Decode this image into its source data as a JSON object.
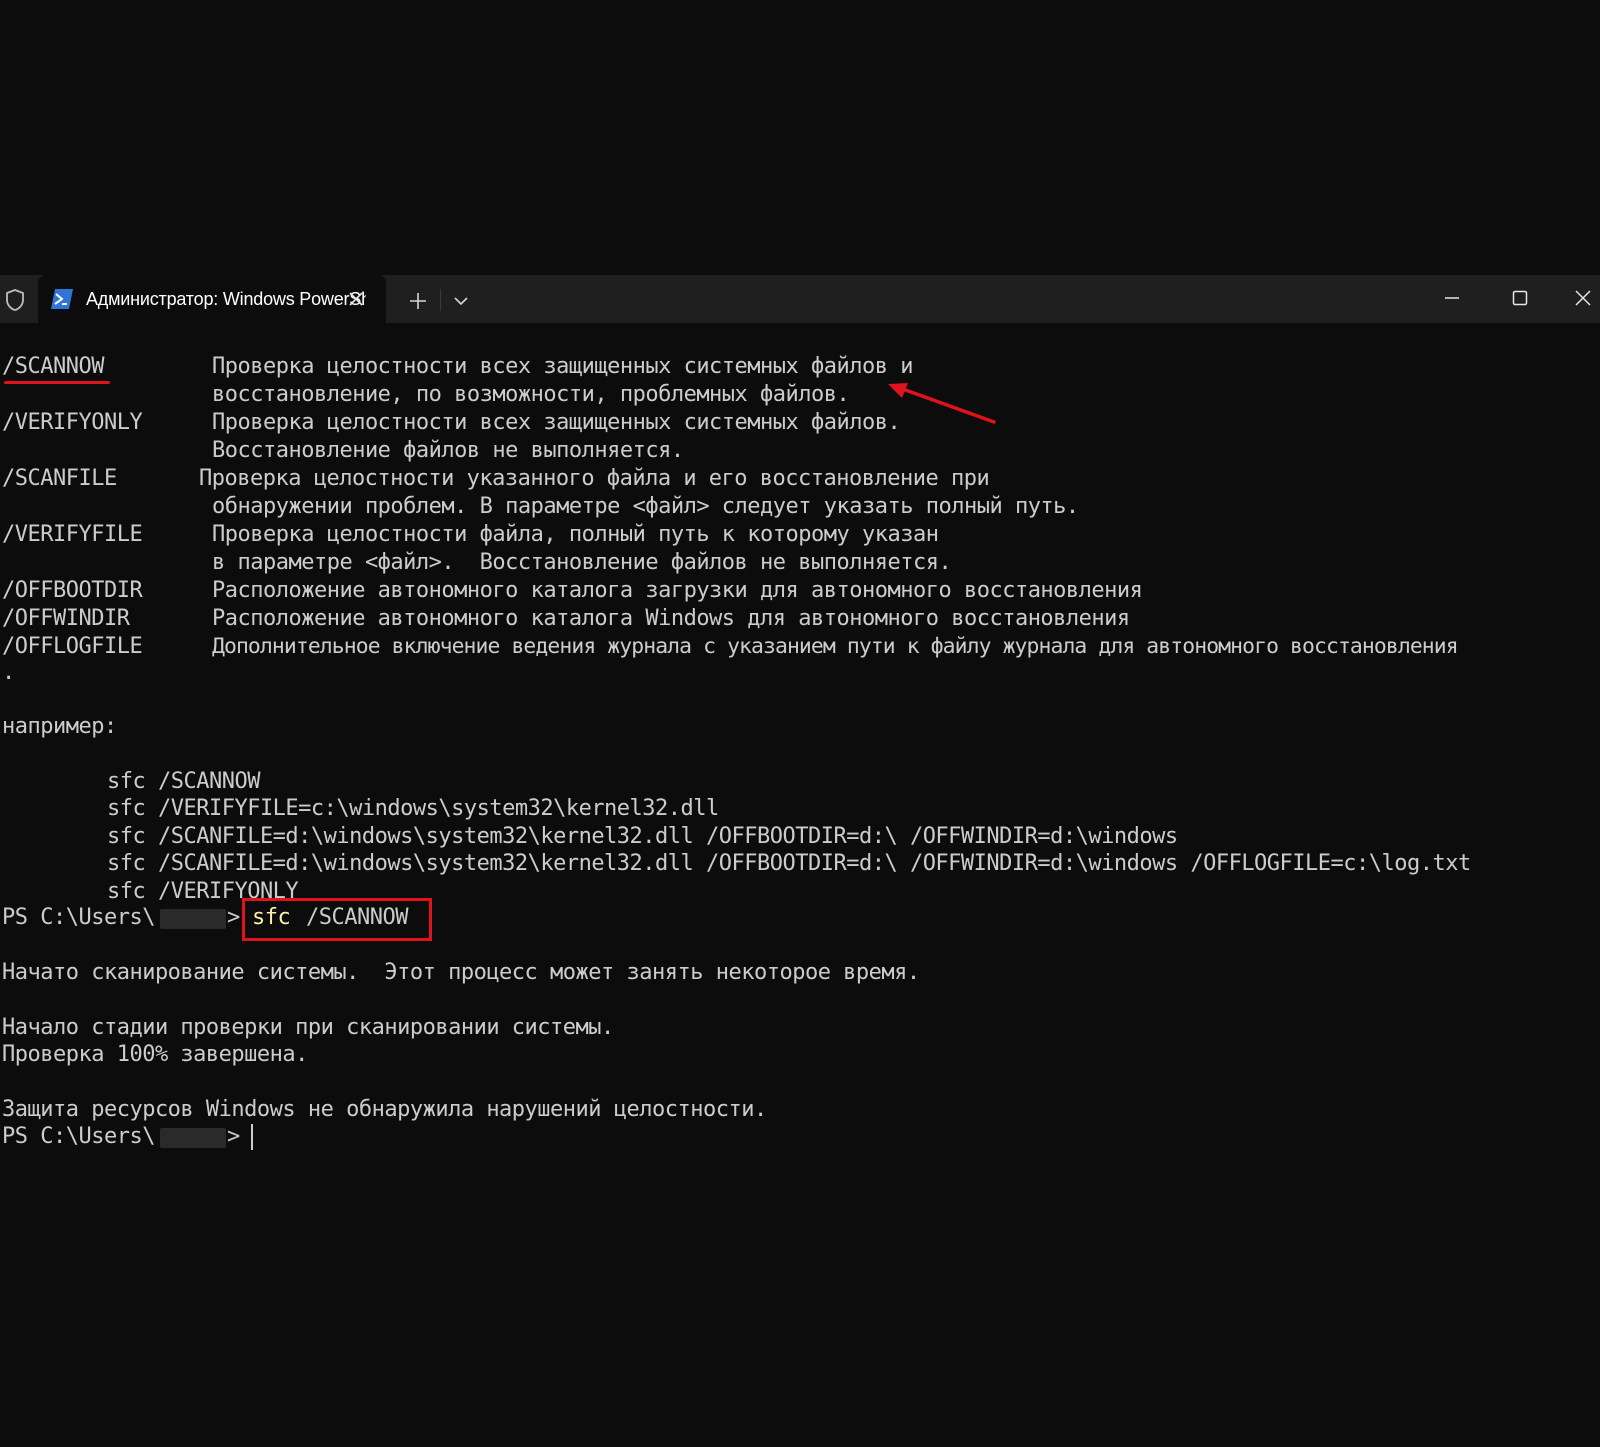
{
  "window": {
    "tab_title": "Администратор: Windows PowerShell"
  },
  "icons": {
    "shield": "shield-icon",
    "powershell": "powershell-icon",
    "close_tab": "close-icon",
    "new_tab": "plus-icon",
    "dropdown": "chevron-down-icon",
    "minimize": "minimize-icon",
    "maximize": "maximize-icon",
    "close_window": "close-icon"
  },
  "colors": {
    "terminal_bg": "#0c0c0c",
    "text": "#cccccc",
    "command": "#f9f1a5",
    "annotation": "#e0121b"
  },
  "help": [
    {
      "switch": "/SCANNOW",
      "text": "Проверка целостности всех защищенных системных файлов и"
    },
    {
      "switch": "",
      "text": "восстановление, по возможности, проблемных файлов."
    },
    {
      "switch": "/VERIFYONLY",
      "text": "Проверка целостности всех защищенных системных файлов."
    },
    {
      "switch": "",
      "text": "Восстановление файлов не выполняется."
    },
    {
      "switch": "/SCANFILE",
      "text": "Проверка целостности указанного файла и его восстановление при"
    },
    {
      "switch": "",
      "text": "обнаружении проблем. В параметре <файл> следует указать полный путь."
    },
    {
      "switch": "/VERIFYFILE",
      "text": "Проверка целостности файла, полный путь к которому указан"
    },
    {
      "switch": "",
      "text": "в параметре <файл>.  Восстановление файлов не выполняется."
    },
    {
      "switch": "/OFFBOOTDIR",
      "text": "Расположение автономного каталога загрузки для автономного восстановления"
    },
    {
      "switch": "/OFFWINDIR",
      "text": "Расположение автономного каталога Windows для автономного восстановления"
    },
    {
      "switch": "/OFFLOGFILE",
      "text": "Дополнительное включение ведения журнала с указанием пути к файлу журнала для автономного восстановления"
    },
    {
      "switch": ".",
      "text": ""
    }
  ],
  "examples_label": "например:",
  "examples": [
    "sfc /SCANNOW",
    "sfc /VERIFYFILE=c:\\windows\\system32\\kernel32.dll",
    "sfc /SCANFILE=d:\\windows\\system32\\kernel32.dll /OFFBOOTDIR=d:\\ /OFFWINDIR=d:\\windows",
    "sfc /SCANFILE=d:\\windows\\system32\\kernel32.dll /OFFBOOTDIR=d:\\ /OFFWINDIR=d:\\windows /OFFLOGFILE=c:\\log.txt",
    "sfc /VERIFYONLY"
  ],
  "prompt": {
    "prefix": "PS C:\\Users\\",
    "suffix": ">",
    "command_name": "sfc",
    "command_arg": "/SCANNOW"
  },
  "output": [
    "Начато сканирование системы.  Этот процесс может занять некоторое время.",
    "Начало стадии проверки при сканировании системы.",
    "Проверка 100% завершена.",
    "Защита ресурсов Windows не обнаружила нарушений целостности."
  ]
}
